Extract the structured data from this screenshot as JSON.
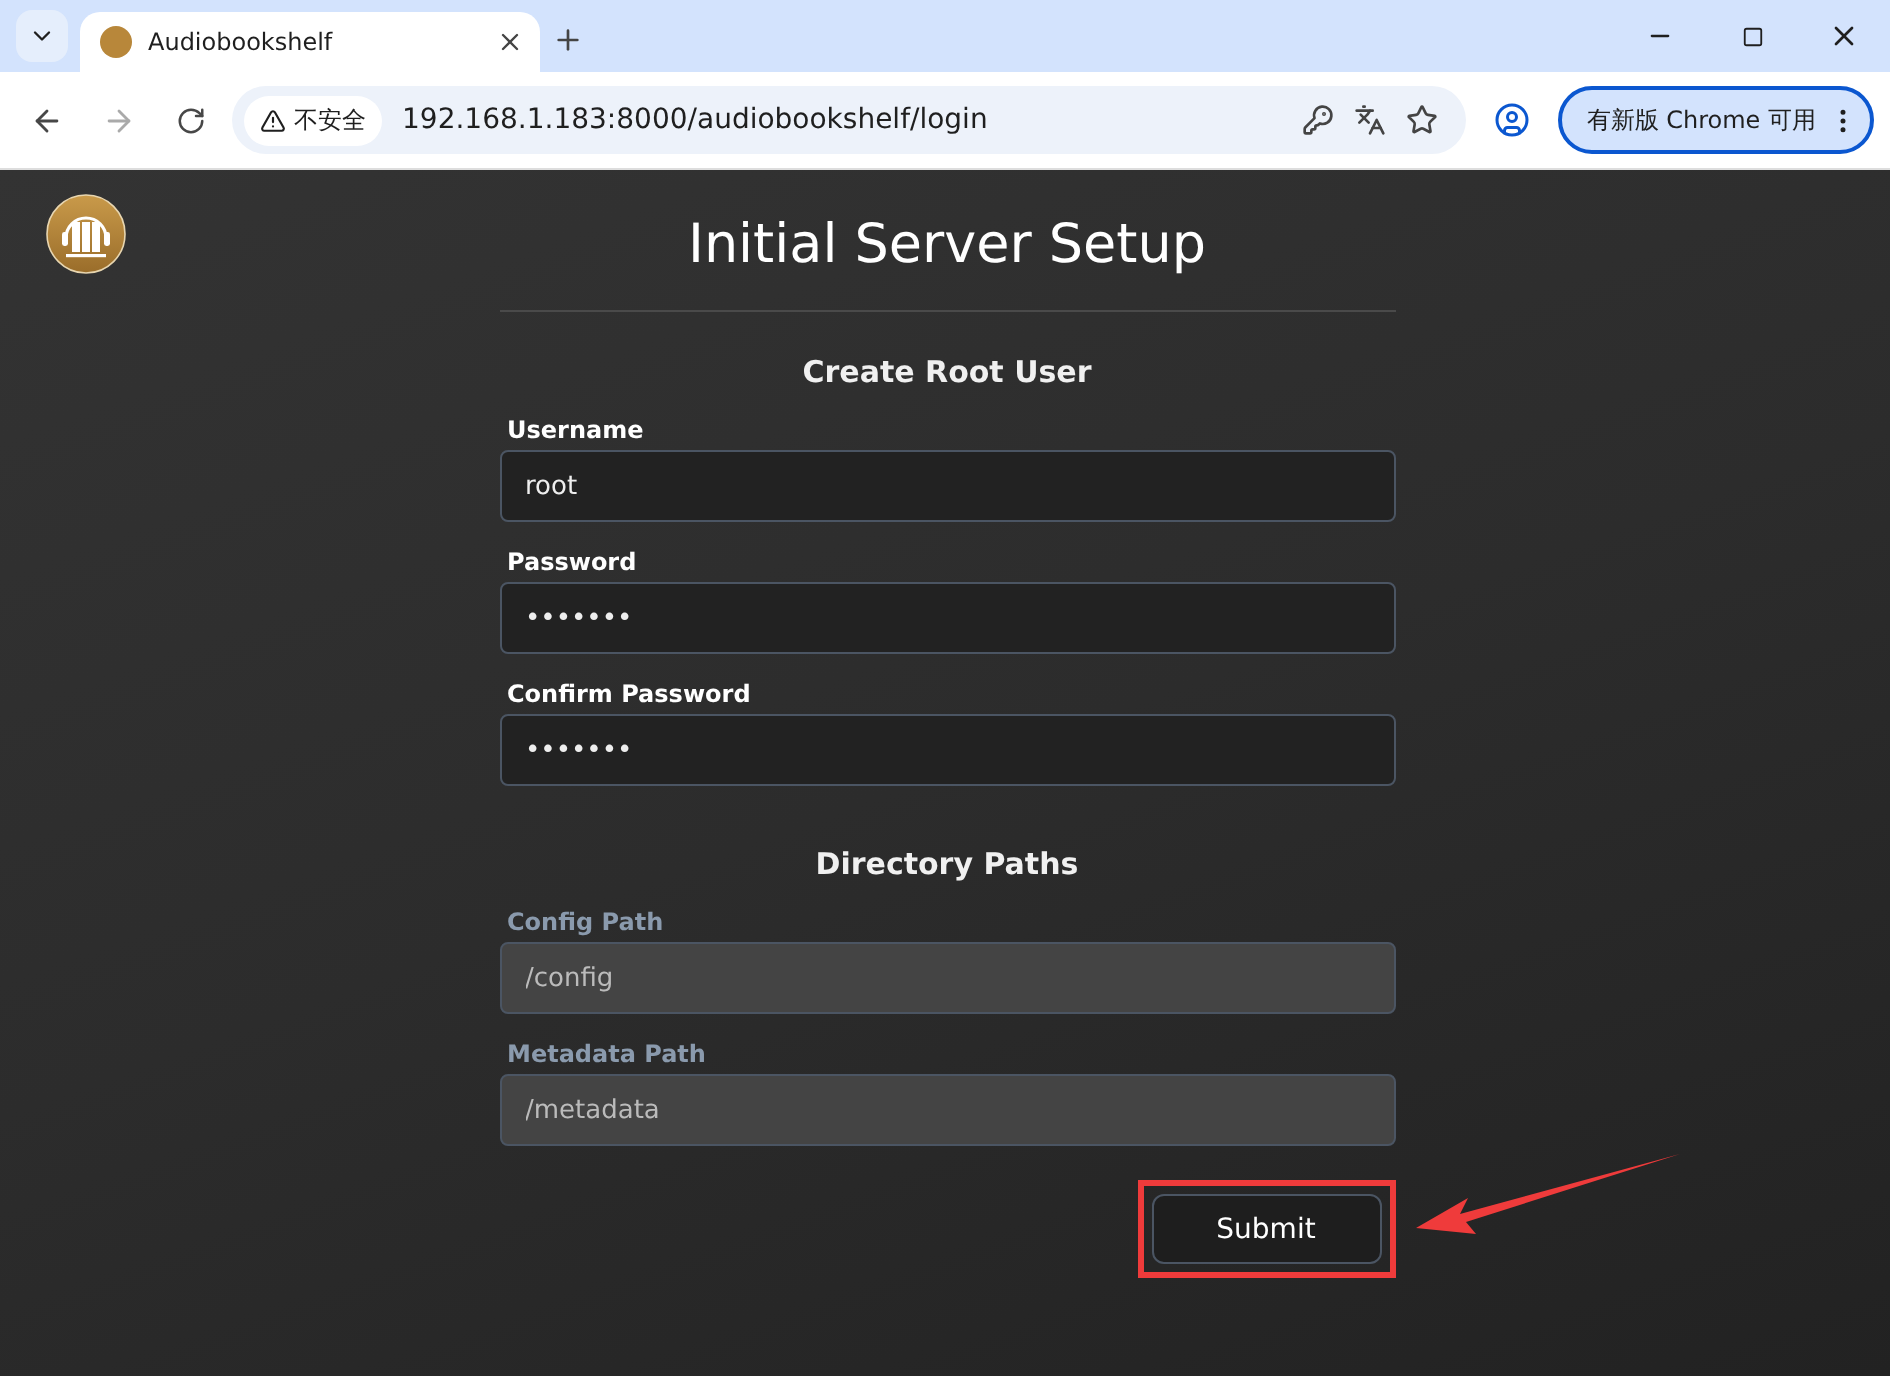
{
  "browser": {
    "tab_title": "Audiobookshelf",
    "security_label": "不安全",
    "url": "192.168.1.183:8000/audiobookshelf/login",
    "update_button": "有新版 Chrome 可用"
  },
  "page": {
    "title": "Initial Server Setup",
    "sections": [
      {
        "heading": "Create Root User",
        "fields": [
          {
            "label": "Username",
            "value": "root",
            "disabled": false
          },
          {
            "label": "Password",
            "value": "•••••••",
            "disabled": false
          },
          {
            "label": "Confirm Password",
            "value": "•••••••",
            "disabled": false
          }
        ]
      },
      {
        "heading": "Directory Paths",
        "fields": [
          {
            "label": "Config Path",
            "value": "/config",
            "disabled": true
          },
          {
            "label": "Metadata Path",
            "value": "/metadata",
            "disabled": true
          }
        ]
      }
    ],
    "submit": "Submit"
  }
}
